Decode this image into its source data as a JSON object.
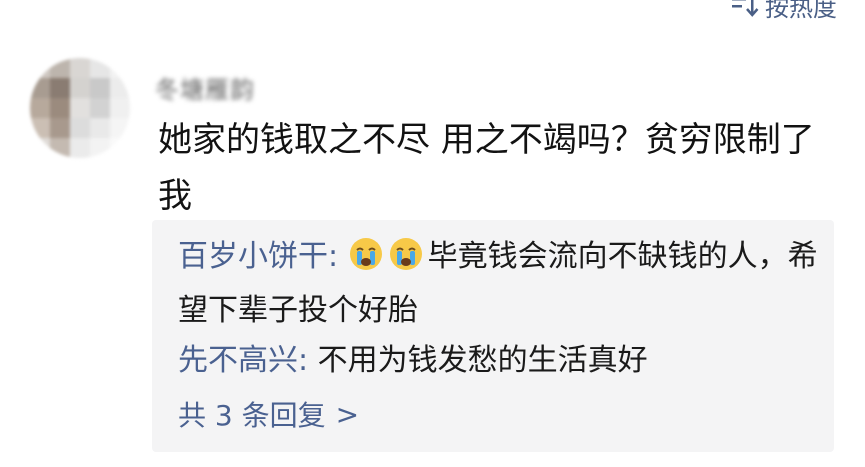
{
  "sort": {
    "label": "按热度",
    "icon": "sort-icon"
  },
  "comment": {
    "username": "冬塘雁韵",
    "text": "她家的钱取之不尽 用之不竭吗？贫穷限制了我"
  },
  "replies": [
    {
      "name": "百岁小饼干:",
      "emojis": [
        "crying-face-emoji",
        "crying-face-emoji"
      ],
      "text": "毕竟钱会流向不缺钱的人，希望下辈子投个好胎"
    },
    {
      "name": "先不高兴:",
      "text": "不用为钱发愁的生活真好"
    }
  ],
  "more_replies": {
    "label": "共 3 条回复",
    "arrow": ">"
  },
  "colors": {
    "link": "#4a6190",
    "reply_bg": "#f4f4f5",
    "text": "#1a1a1a"
  }
}
